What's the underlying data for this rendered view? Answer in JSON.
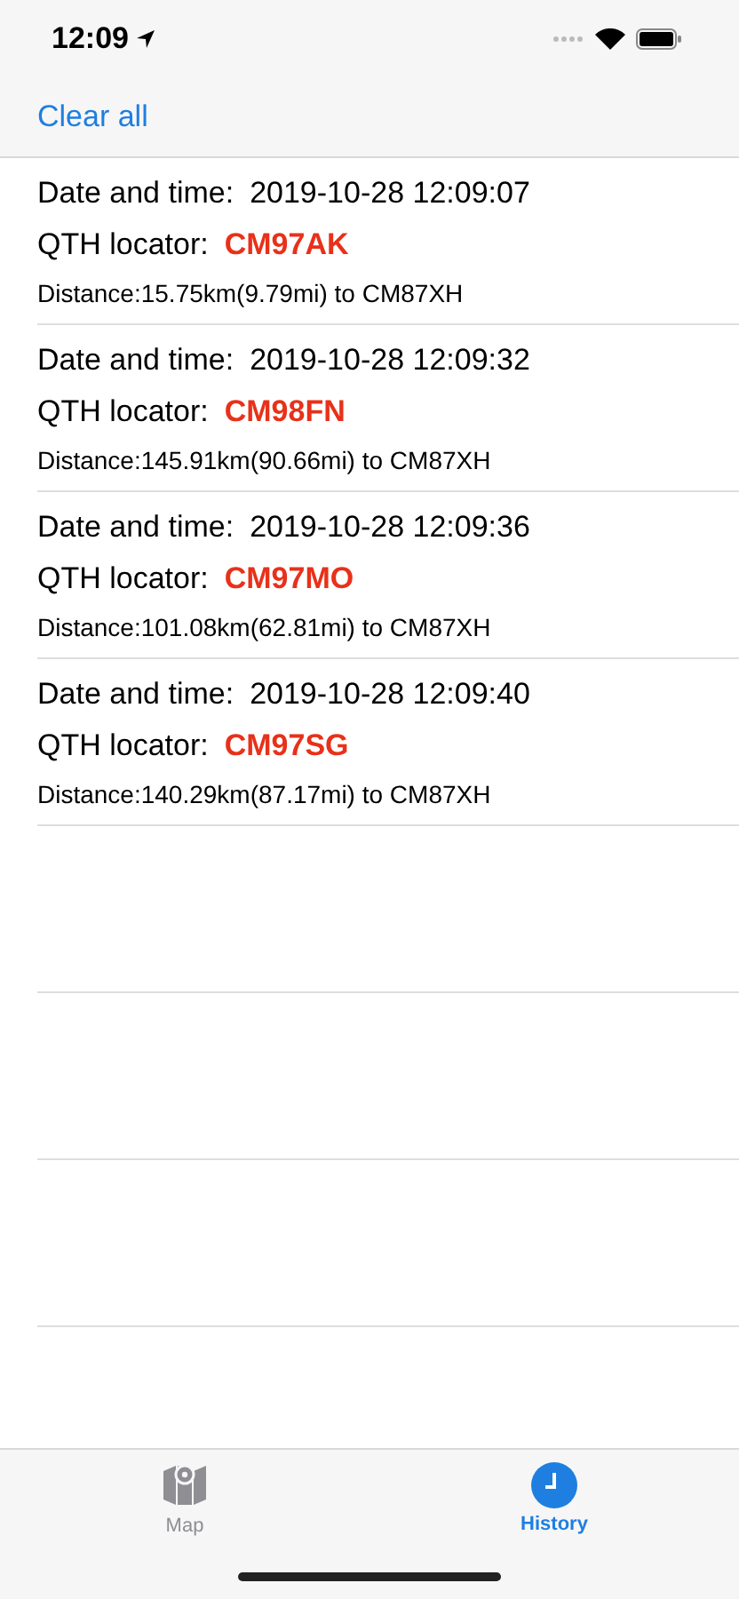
{
  "status_bar": {
    "time": "12:09"
  },
  "nav": {
    "action": "Clear all"
  },
  "history": [
    {
      "date_label": "Date and time:",
      "date": "2019-10-28 12:09:07",
      "locator_label": "QTH locator:",
      "locator": "CM97AK",
      "distance": "Distance:15.75km(9.79mi) to CM87XH"
    },
    {
      "date_label": "Date and time:",
      "date": "2019-10-28 12:09:32",
      "locator_label": "QTH locator:",
      "locator": "CM98FN",
      "distance": "Distance:145.91km(90.66mi) to CM87XH"
    },
    {
      "date_label": "Date and time:",
      "date": "2019-10-28 12:09:36",
      "locator_label": "QTH locator:",
      "locator": "CM97MO",
      "distance": "Distance:101.08km(62.81mi) to CM87XH"
    },
    {
      "date_label": "Date and time:",
      "date": "2019-10-28 12:09:40",
      "locator_label": "QTH locator:",
      "locator": "CM97SG",
      "distance": "Distance:140.29km(87.17mi) to CM87XH"
    }
  ],
  "tabs": [
    {
      "label": "Map",
      "kind": "map",
      "selected": false
    },
    {
      "label": "History",
      "kind": "history",
      "selected": true
    }
  ]
}
